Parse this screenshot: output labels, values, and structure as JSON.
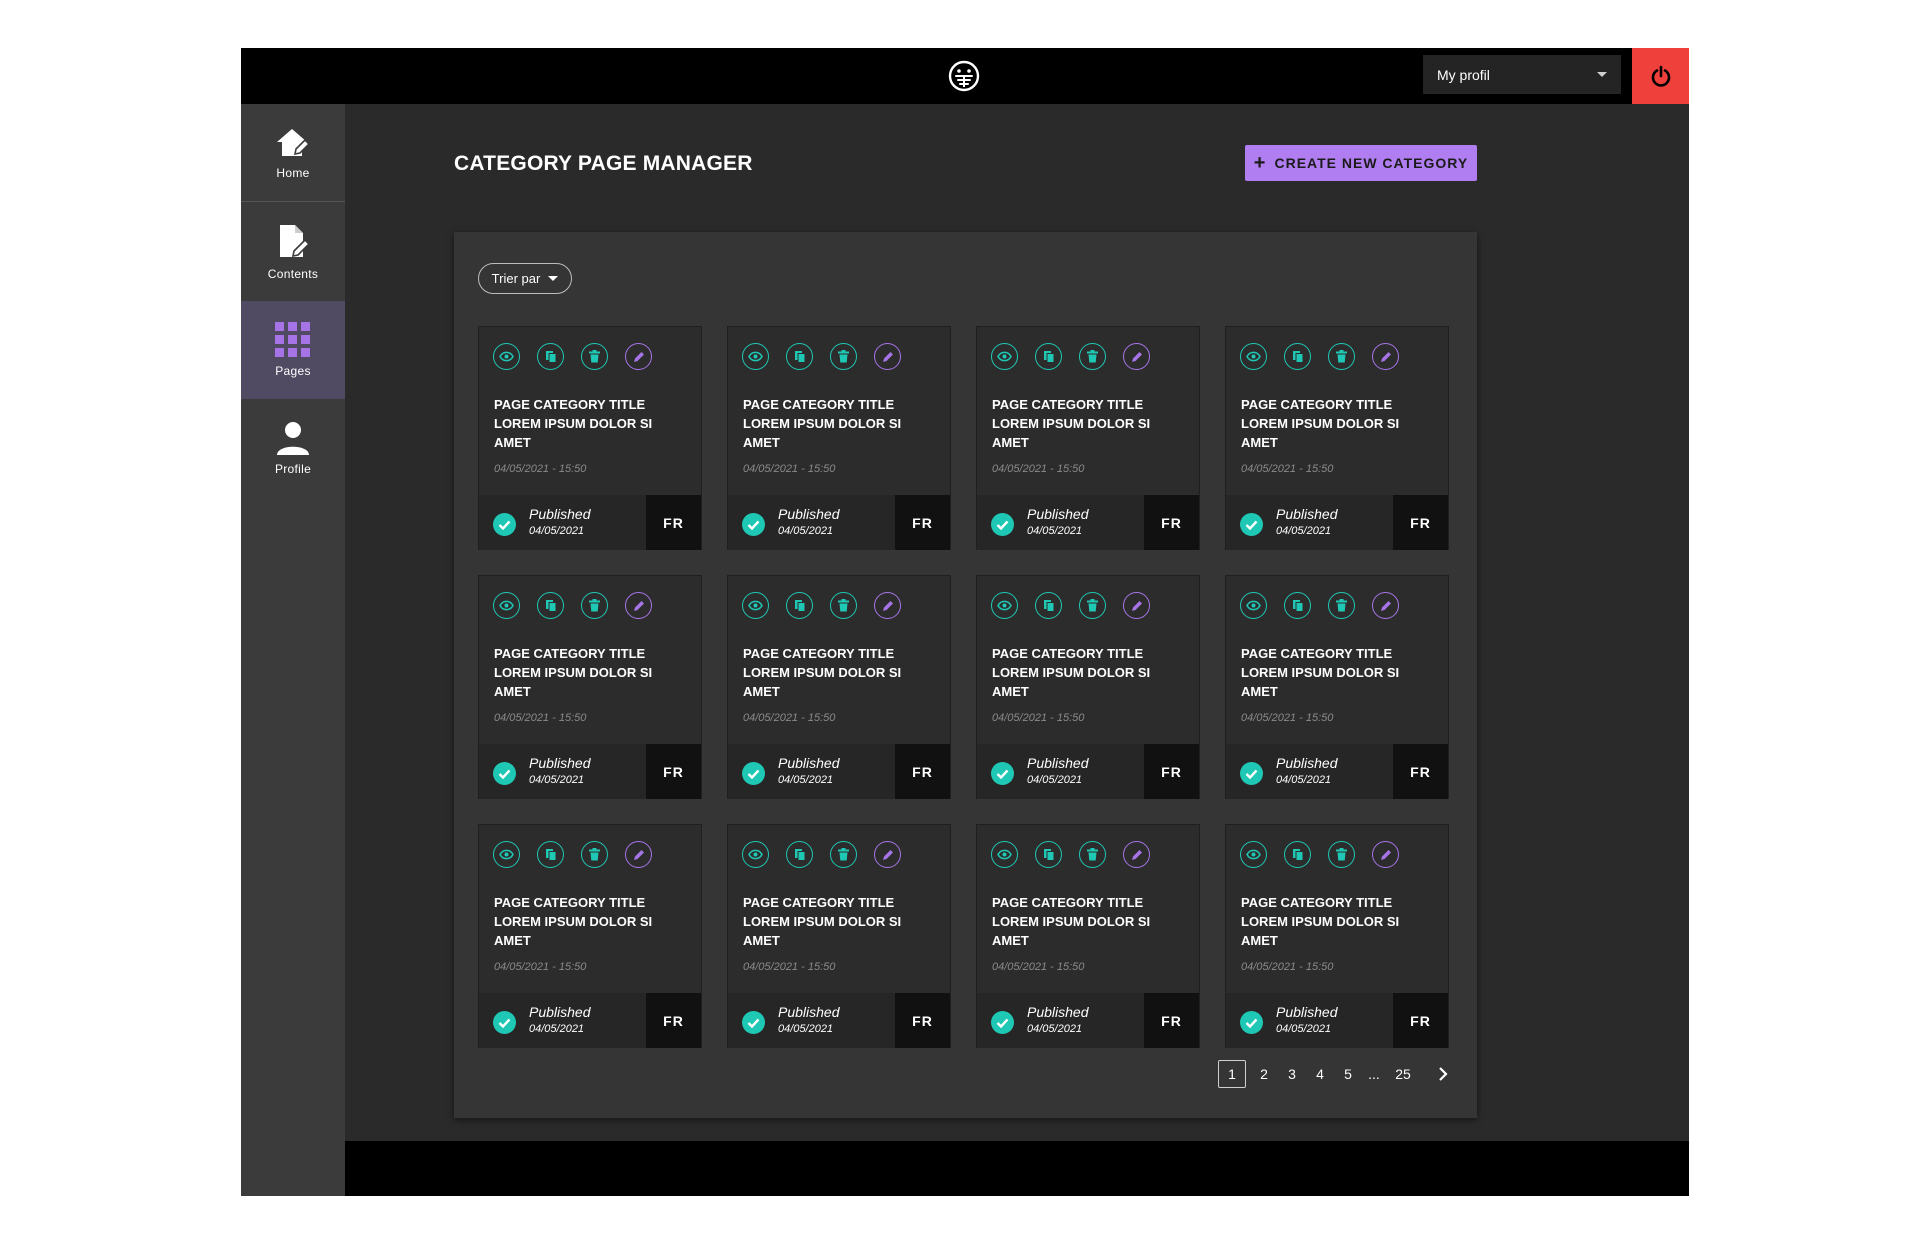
{
  "header": {
    "profile_select": "My profil"
  },
  "sidebar": {
    "items": [
      {
        "label": "Home"
      },
      {
        "label": "Contents"
      },
      {
        "label": "Pages"
      },
      {
        "label": "Profile"
      }
    ],
    "active": "Pages"
  },
  "main": {
    "title": "CATEGORY PAGE MANAGER",
    "create_button": "CREATE NEW CATEGORY",
    "sort_label": "Trier par"
  },
  "cards": [
    {
      "title": "PAGE CATEGORY TITLE LOREM IPSUM DOLOR SI AMET",
      "date": "04/05/2021 - 15:50",
      "status": "Published",
      "status_date": "04/05/2021",
      "lang": "FR"
    },
    {
      "title": "PAGE CATEGORY TITLE LOREM IPSUM DOLOR SI AMET",
      "date": "04/05/2021 - 15:50",
      "status": "Published",
      "status_date": "04/05/2021",
      "lang": "FR"
    },
    {
      "title": "PAGE CATEGORY TITLE LOREM IPSUM DOLOR SI AMET",
      "date": "04/05/2021 - 15:50",
      "status": "Published",
      "status_date": "04/05/2021",
      "lang": "FR"
    },
    {
      "title": "PAGE CATEGORY TITLE LOREM IPSUM DOLOR SI AMET",
      "date": "04/05/2021 - 15:50",
      "status": "Published",
      "status_date": "04/05/2021",
      "lang": "FR"
    },
    {
      "title": "PAGE CATEGORY TITLE LOREM IPSUM DOLOR SI AMET",
      "date": "04/05/2021 - 15:50",
      "status": "Published",
      "status_date": "04/05/2021",
      "lang": "FR"
    },
    {
      "title": "PAGE CATEGORY TITLE LOREM IPSUM DOLOR SI AMET",
      "date": "04/05/2021 - 15:50",
      "status": "Published",
      "status_date": "04/05/2021",
      "lang": "FR"
    },
    {
      "title": "PAGE CATEGORY TITLE LOREM IPSUM DOLOR SI AMET",
      "date": "04/05/2021 - 15:50",
      "status": "Published",
      "status_date": "04/05/2021",
      "lang": "FR"
    },
    {
      "title": "PAGE CATEGORY TITLE LOREM IPSUM DOLOR SI AMET",
      "date": "04/05/2021 - 15:50",
      "status": "Published",
      "status_date": "04/05/2021",
      "lang": "FR"
    },
    {
      "title": "PAGE CATEGORY TITLE LOREM IPSUM DOLOR SI AMET",
      "date": "04/05/2021 - 15:50",
      "status": "Published",
      "status_date": "04/05/2021",
      "lang": "FR"
    },
    {
      "title": "PAGE CATEGORY TITLE LOREM IPSUM DOLOR SI AMET",
      "date": "04/05/2021 - 15:50",
      "status": "Published",
      "status_date": "04/05/2021",
      "lang": "FR"
    },
    {
      "title": "PAGE CATEGORY TITLE LOREM IPSUM DOLOR SI AMET",
      "date": "04/05/2021 - 15:50",
      "status": "Published",
      "status_date": "04/05/2021",
      "lang": "FR"
    },
    {
      "title": "PAGE CATEGORY TITLE LOREM IPSUM DOLOR SI AMET",
      "date": "04/05/2021 - 15:50",
      "status": "Published",
      "status_date": "04/05/2021",
      "lang": "FR"
    }
  ],
  "card_action_icons": [
    "eye-icon",
    "copy-icon",
    "trash-icon",
    "pencil-icon"
  ],
  "pagination": {
    "current": "1",
    "pages": [
      "1",
      "2",
      "3",
      "4",
      "5",
      "...",
      "25"
    ]
  },
  "colors": {
    "accent_purple": "#b07ef0",
    "accent_teal": "#1fc8b4",
    "power_red": "#f0403c",
    "sidebar_active": "#514a63"
  }
}
